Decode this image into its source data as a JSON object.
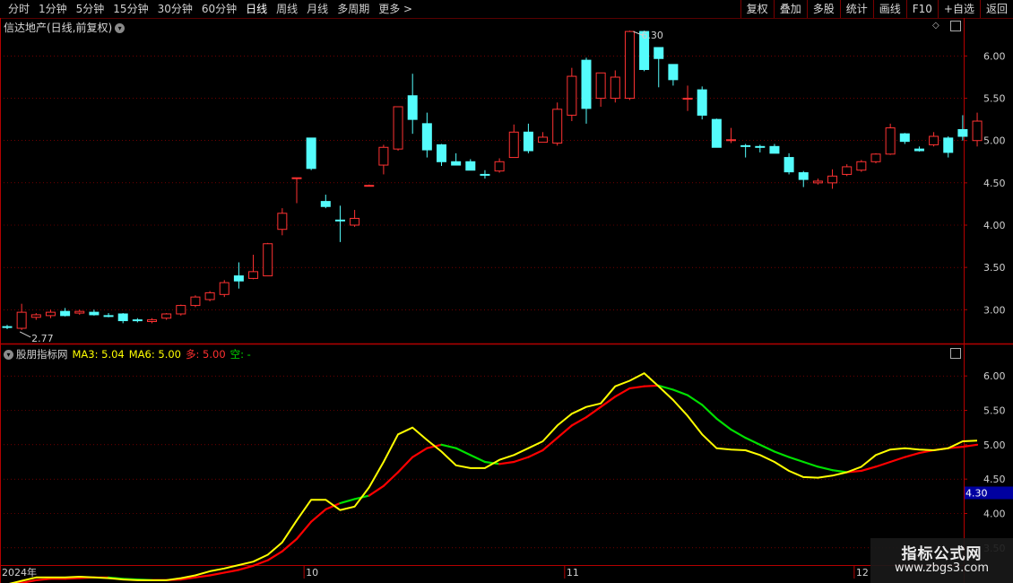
{
  "toolbar": {
    "periods": [
      "分时",
      "1分钟",
      "5分钟",
      "15分钟",
      "30分钟",
      "60分钟",
      "日线",
      "周线",
      "月线",
      "多周期",
      "更多"
    ],
    "active_period": "日线",
    "right_buttons": [
      "复权",
      "叠加",
      "多股",
      "统计",
      "画线",
      "F10",
      "+自选",
      "返回"
    ],
    "more_arrow": ">"
  },
  "stock_title": "信达地产(日线,前复权)",
  "indicator": {
    "name": "股朋指标网",
    "ma3_label": "MA3: 5.04",
    "ma6_label": "MA6: 5.00",
    "duo_label": "多: 5.00",
    "kong_label": "空: -"
  },
  "watermark": {
    "line1": "指标公式网",
    "line2": "www.zbgs3.com"
  },
  "colors": {
    "up": "#ff3232",
    "down": "#54fcfc",
    "ma3": "#ffff00",
    "duo": "#ff0000",
    "kong": "#00e000",
    "axis": "#b40000",
    "grid": "#b40000",
    "text": "#d0d0d0",
    "badge": "#0000a0"
  },
  "chart_data": [
    {
      "type": "candlestick",
      "title": "信达地产(日线,前复权)",
      "x_labels": [
        "2024年",
        "10",
        "11",
        "12"
      ],
      "x_label_index": [
        0,
        21,
        39,
        59
      ],
      "ylim": [
        2.6,
        6.45
      ],
      "yticks": [
        "3.00",
        "3.50",
        "4.00",
        "4.50",
        "5.00",
        "5.50",
        "6.00"
      ],
      "annotations": {
        "high": "6.30",
        "low": "2.77"
      },
      "ohlc": [
        [
          2.8,
          2.82,
          2.77,
          2.79
        ],
        [
          2.78,
          3.07,
          2.76,
          2.97
        ],
        [
          2.91,
          2.96,
          2.88,
          2.94
        ],
        [
          2.93,
          3.0,
          2.9,
          2.97
        ],
        [
          2.98,
          3.02,
          2.92,
          2.93
        ],
        [
          2.96,
          3.0,
          2.94,
          2.98
        ],
        [
          2.97,
          3.0,
          2.93,
          2.94
        ],
        [
          2.93,
          2.96,
          2.91,
          2.92
        ],
        [
          2.95,
          2.96,
          2.84,
          2.87
        ],
        [
          2.88,
          2.9,
          2.85,
          2.87
        ],
        [
          2.86,
          2.9,
          2.84,
          2.88
        ],
        [
          2.9,
          2.96,
          2.88,
          2.95
        ],
        [
          2.95,
          3.06,
          2.93,
          3.05
        ],
        [
          3.05,
          3.17,
          3.03,
          3.15
        ],
        [
          3.12,
          3.22,
          3.1,
          3.2
        ],
        [
          3.18,
          3.35,
          3.15,
          3.32
        ],
        [
          3.4,
          3.56,
          3.25,
          3.34
        ],
        [
          3.37,
          3.65,
          3.36,
          3.45
        ],
        [
          3.4,
          3.79,
          3.4,
          3.78
        ],
        [
          3.95,
          4.2,
          3.88,
          4.14
        ],
        [
          4.55,
          4.56,
          4.26,
          4.56
        ],
        [
          5.03,
          5.03,
          4.65,
          4.67
        ],
        [
          4.28,
          4.36,
          4.2,
          4.22
        ],
        [
          4.06,
          4.23,
          3.8,
          4.05
        ],
        [
          4.0,
          4.18,
          3.98,
          4.08
        ],
        [
          4.47,
          4.48,
          4.46,
          4.47
        ],
        [
          4.71,
          4.95,
          4.6,
          4.92
        ],
        [
          4.9,
          5.4,
          4.88,
          5.4
        ],
        [
          5.53,
          5.79,
          5.08,
          5.25
        ],
        [
          5.2,
          5.33,
          4.8,
          4.89
        ],
        [
          4.95,
          4.96,
          4.7,
          4.75
        ],
        [
          4.75,
          4.85,
          4.72,
          4.71
        ],
        [
          4.75,
          4.78,
          4.65,
          4.65
        ],
        [
          4.6,
          4.65,
          4.55,
          4.59
        ],
        [
          4.64,
          4.79,
          4.62,
          4.75
        ],
        [
          4.8,
          5.19,
          4.8,
          5.1
        ],
        [
          5.1,
          5.2,
          4.85,
          4.88
        ],
        [
          4.98,
          5.1,
          4.98,
          5.04
        ],
        [
          4.97,
          5.45,
          4.94,
          5.37
        ],
        [
          5.3,
          5.86,
          5.23,
          5.76
        ],
        [
          5.95,
          5.98,
          5.2,
          5.38
        ],
        [
          5.5,
          5.75,
          5.4,
          5.8
        ],
        [
          5.5,
          5.83,
          5.45,
          5.75
        ],
        [
          5.5,
          6.3,
          5.48,
          6.29
        ],
        [
          6.29,
          6.3,
          5.82,
          5.84
        ],
        [
          6.1,
          6.1,
          5.63,
          5.97
        ],
        [
          5.9,
          5.9,
          5.65,
          5.72
        ],
        [
          5.5,
          5.65,
          5.35,
          5.5
        ],
        [
          5.6,
          5.64,
          5.25,
          5.3
        ],
        [
          5.25,
          5.26,
          4.92,
          4.92
        ],
        [
          5.0,
          5.15,
          4.97,
          5.01
        ],
        [
          4.94,
          4.96,
          4.8,
          4.93
        ],
        [
          4.93,
          4.95,
          4.86,
          4.92
        ],
        [
          4.93,
          4.96,
          4.85,
          4.85
        ],
        [
          4.8,
          4.85,
          4.6,
          4.63
        ],
        [
          4.62,
          4.64,
          4.45,
          4.54
        ],
        [
          4.5,
          4.55,
          4.48,
          4.52
        ],
        [
          4.5,
          4.66,
          4.43,
          4.58
        ],
        [
          4.6,
          4.72,
          4.58,
          4.69
        ],
        [
          4.65,
          4.77,
          4.63,
          4.75
        ],
        [
          4.75,
          4.85,
          4.73,
          4.84
        ],
        [
          4.84,
          5.2,
          4.83,
          5.15
        ],
        [
          5.08,
          5.09,
          4.96,
          4.99
        ],
        [
          4.9,
          4.93,
          4.87,
          4.88
        ],
        [
          4.95,
          5.1,
          4.93,
          5.05
        ],
        [
          5.03,
          5.05,
          4.8,
          4.86
        ],
        [
          5.13,
          5.3,
          5.0,
          5.05
        ],
        [
          5.0,
          5.33,
          4.93,
          5.23
        ]
      ]
    },
    {
      "type": "line",
      "title": "股朋指标网",
      "ylim": [
        3.25,
        6.25
      ],
      "yticks": [
        "3.50",
        "4.00",
        "4.50",
        "5.00",
        "5.50",
        "6.00"
      ],
      "badge": "4.30",
      "series": [
        {
          "name": "MA3",
          "values": [
            2.97,
            3.02,
            3.07,
            3.07,
            3.07,
            3.08,
            3.07,
            3.06,
            3.04,
            3.03,
            3.03,
            3.03,
            3.06,
            3.1,
            3.16,
            3.2,
            3.25,
            3.3,
            3.4,
            3.58,
            3.9,
            4.2,
            4.2,
            4.05,
            4.1,
            4.38,
            4.75,
            5.15,
            5.25,
            5.07,
            4.9,
            4.7,
            4.66,
            4.66,
            4.78,
            4.85,
            4.95,
            5.05,
            5.28,
            5.45,
            5.55,
            5.6,
            5.85,
            5.93,
            6.04,
            5.85,
            5.65,
            5.42,
            5.15,
            4.95,
            4.93,
            4.92,
            4.85,
            4.75,
            4.62,
            4.53,
            4.52,
            4.55,
            4.6,
            4.68,
            4.85,
            4.93,
            4.95,
            4.93,
            4.92,
            4.95,
            5.05,
            5.06
          ]
        },
        {
          "name": "多",
          "values": [
            2.97,
            2.99,
            3.03,
            3.05,
            3.05,
            3.06,
            3.07,
            3.07,
            3.05,
            3.04,
            3.03,
            3.03,
            3.04,
            3.07,
            3.1,
            3.14,
            3.18,
            3.24,
            3.32,
            3.45,
            3.63,
            3.88,
            4.06,
            4.15,
            4.21,
            4.26,
            4.4,
            4.6,
            4.82,
            4.95,
            5.0,
            4.95,
            4.85,
            4.75,
            4.72,
            4.75,
            4.82,
            4.92,
            5.1,
            5.28,
            5.4,
            5.55,
            5.7,
            5.82,
            5.85,
            5.86,
            5.8,
            5.72,
            5.58,
            5.38,
            5.22,
            5.1,
            5.0,
            4.9,
            4.82,
            4.75,
            4.68,
            4.63,
            4.6,
            4.62,
            4.68,
            4.75,
            4.82,
            4.88,
            4.92,
            4.95,
            4.97,
            5.0
          ]
        }
      ]
    }
  ]
}
